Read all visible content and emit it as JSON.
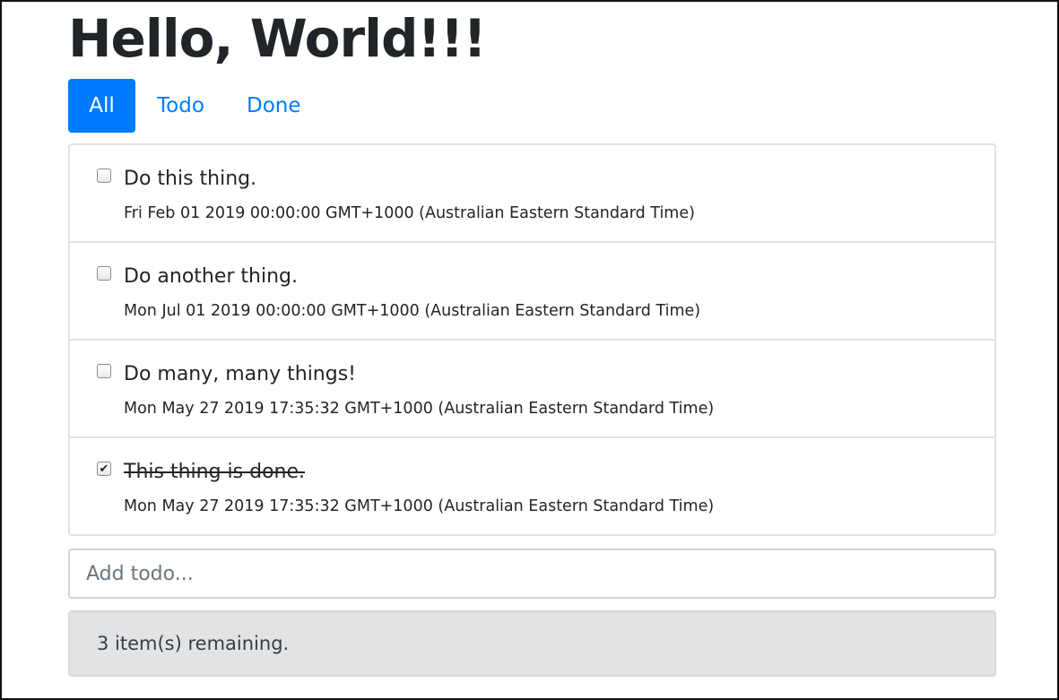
{
  "header": {
    "title": "Hello, World!!!"
  },
  "tabs": [
    {
      "label": "All",
      "active": true
    },
    {
      "label": "Todo",
      "active": false
    },
    {
      "label": "Done",
      "active": false
    }
  ],
  "todos": [
    {
      "text": "Do this thing.",
      "date": "Fri Feb 01 2019 00:00:00 GMT+1000 (Australian Eastern Standard Time)",
      "checked": false
    },
    {
      "text": "Do another thing.",
      "date": "Mon Jul 01 2019 00:00:00 GMT+1000 (Australian Eastern Standard Time)",
      "checked": false
    },
    {
      "text": "Do many, many things!",
      "date": "Mon May 27 2019 17:35:32 GMT+1000 (Australian Eastern Standard Time)",
      "checked": false
    },
    {
      "text": "This thing is done.",
      "date": "Mon May 27 2019 17:35:32 GMT+1000 (Australian Eastern Standard Time)",
      "checked": true
    }
  ],
  "add_todo": {
    "value": "",
    "placeholder": "Add todo..."
  },
  "footer": {
    "remaining": "3 item(s) remaining."
  },
  "colors": {
    "accent": "#007bff",
    "footer_bg": "#e2e3e5",
    "border": "#dfe2e6"
  },
  "icons": {
    "checkbox_checked": "check-icon"
  }
}
